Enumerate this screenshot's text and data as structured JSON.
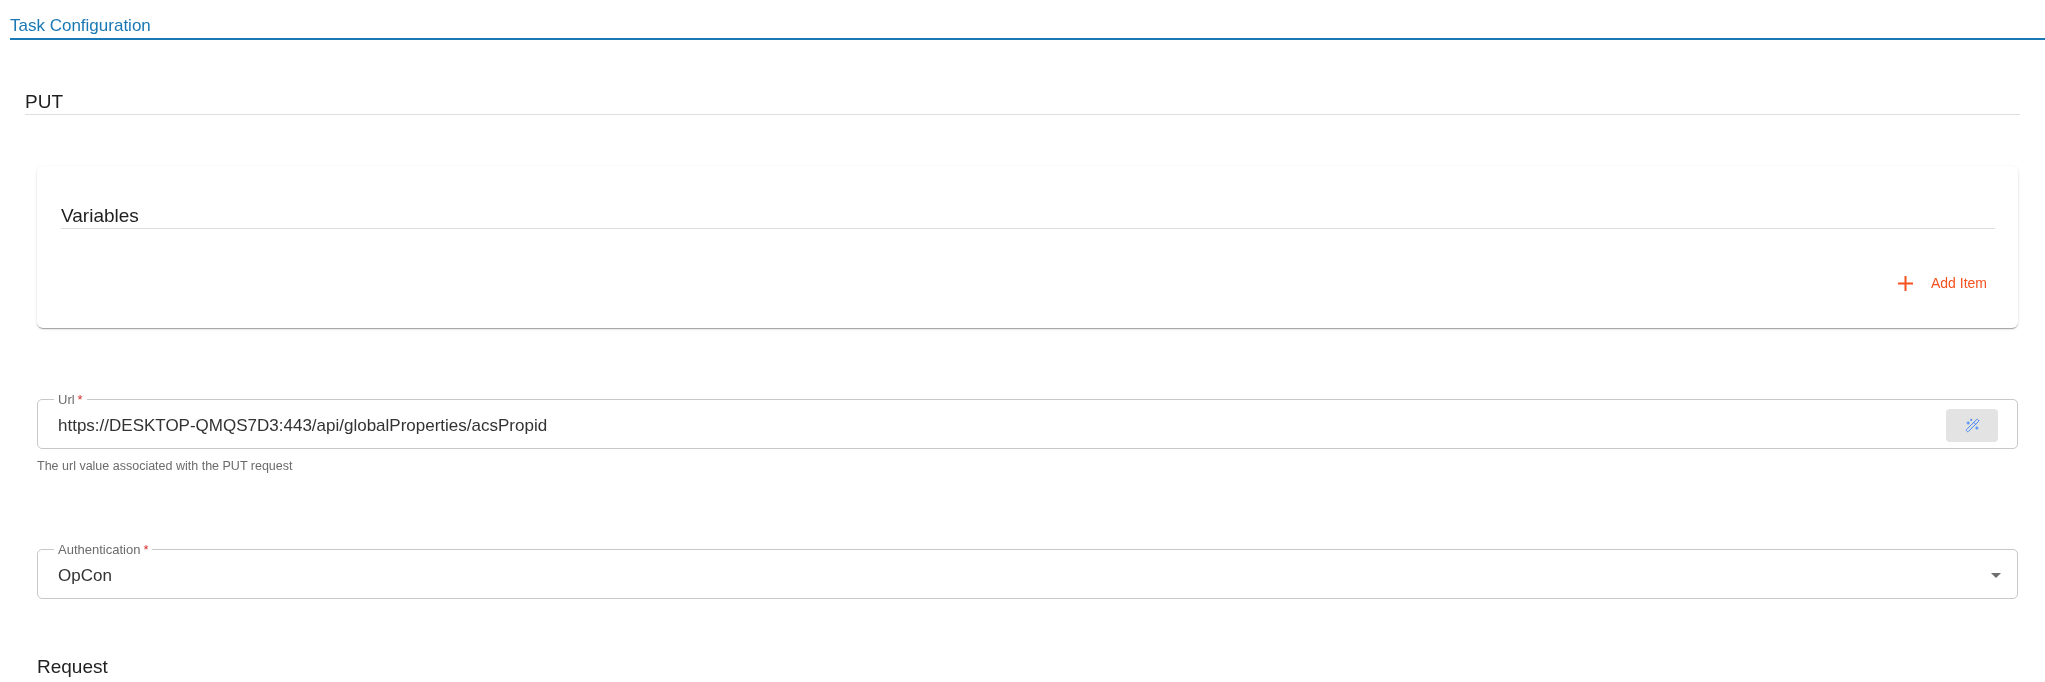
{
  "header": {
    "title": "Task Configuration"
  },
  "section": {
    "title": "PUT"
  },
  "variables": {
    "title": "Variables",
    "add_button": {
      "label": "Add Item"
    }
  },
  "fields": [
    {
      "kind": "text",
      "label": "Url",
      "required_mark": "*",
      "value": "https://DESKTOP-QMQS7D3:443/api/globalProperties/acsPropid",
      "helper": "The url value associated with the PUT request"
    },
    {
      "kind": "select",
      "label": "Authentication",
      "required_mark": "*",
      "value": "OpCon"
    }
  ],
  "next_section": {
    "title": "Request"
  }
}
